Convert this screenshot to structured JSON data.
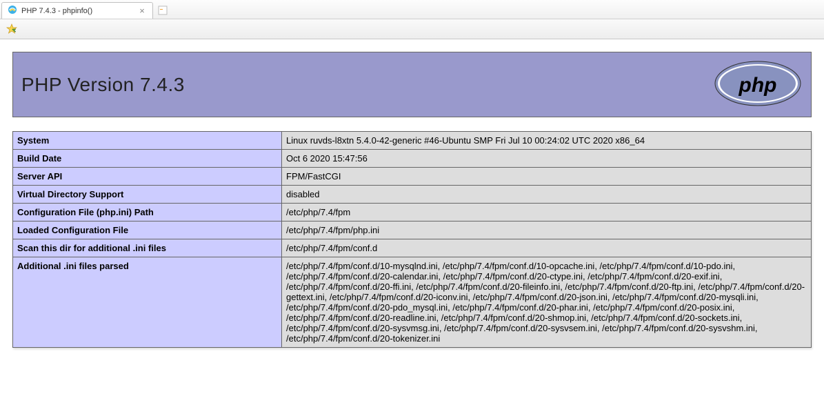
{
  "browser": {
    "tab_title": "PHP 7.4.3 - phpinfo()"
  },
  "header": {
    "title": "PHP Version 7.4.3",
    "logo_text": "php"
  },
  "rows": [
    {
      "key": "System",
      "val": "Linux ruvds-l8xtn 5.4.0-42-generic #46-Ubuntu SMP Fri Jul 10 00:24:02 UTC 2020 x86_64"
    },
    {
      "key": "Build Date",
      "val": "Oct 6 2020 15:47:56"
    },
    {
      "key": "Server API",
      "val": "FPM/FastCGI"
    },
    {
      "key": "Virtual Directory Support",
      "val": "disabled"
    },
    {
      "key": "Configuration File (php.ini) Path",
      "val": "/etc/php/7.4/fpm"
    },
    {
      "key": "Loaded Configuration File",
      "val": "/etc/php/7.4/fpm/php.ini"
    },
    {
      "key": "Scan this dir for additional .ini files",
      "val": "/etc/php/7.4/fpm/conf.d"
    },
    {
      "key": "Additional .ini files parsed",
      "val": "/etc/php/7.4/fpm/conf.d/10-mysqlnd.ini, /etc/php/7.4/fpm/conf.d/10-opcache.ini, /etc/php/7.4/fpm/conf.d/10-pdo.ini, /etc/php/7.4/fpm/conf.d/20-calendar.ini, /etc/php/7.4/fpm/conf.d/20-ctype.ini, /etc/php/7.4/fpm/conf.d/20-exif.ini, /etc/php/7.4/fpm/conf.d/20-ffi.ini, /etc/php/7.4/fpm/conf.d/20-fileinfo.ini, /etc/php/7.4/fpm/conf.d/20-ftp.ini, /etc/php/7.4/fpm/conf.d/20-gettext.ini, /etc/php/7.4/fpm/conf.d/20-iconv.ini, /etc/php/7.4/fpm/conf.d/20-json.ini, /etc/php/7.4/fpm/conf.d/20-mysqli.ini, /etc/php/7.4/fpm/conf.d/20-pdo_mysql.ini, /etc/php/7.4/fpm/conf.d/20-phar.ini, /etc/php/7.4/fpm/conf.d/20-posix.ini, /etc/php/7.4/fpm/conf.d/20-readline.ini, /etc/php/7.4/fpm/conf.d/20-shmop.ini, /etc/php/7.4/fpm/conf.d/20-sockets.ini, /etc/php/7.4/fpm/conf.d/20-sysvmsg.ini, /etc/php/7.4/fpm/conf.d/20-sysvsem.ini, /etc/php/7.4/fpm/conf.d/20-sysvshm.ini, /etc/php/7.4/fpm/conf.d/20-tokenizer.ini"
    }
  ]
}
